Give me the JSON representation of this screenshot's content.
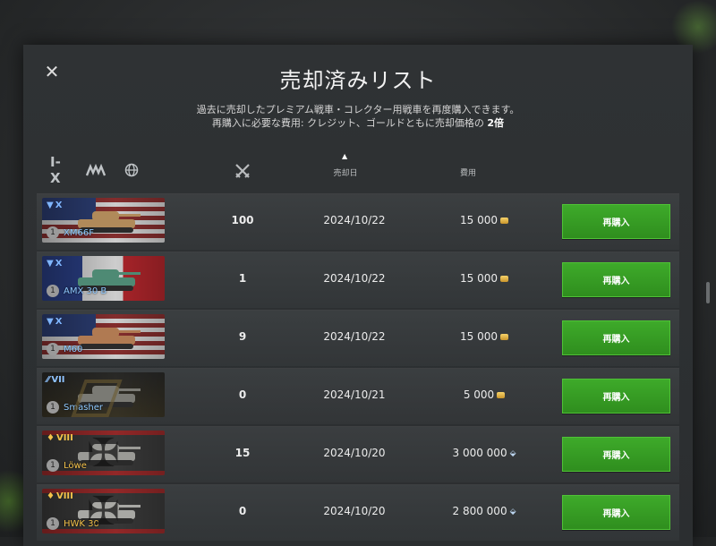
{
  "title": "売却済みリスト",
  "subtitle_line1": "過去に売却したプレミアム戦車・コレクター用戦車を再度購入できます。",
  "subtitle_line2_prefix": "再購入に必要な費用: クレジット、ゴールドともに売却価格の",
  "subtitle_line2_emphasis": "2倍",
  "filters": {
    "tier_label": "I-X",
    "class_icon": "vehicle-class-icon",
    "nation_icon": "globe-icon"
  },
  "columns": {
    "battles_icon": "crossed-swords-icon",
    "date": "売却日",
    "cost": "費用"
  },
  "sort_indicator": "▲",
  "rows": [
    {
      "tier": "X",
      "tier_style": "blue",
      "name": "XM66F",
      "name_style": "blue",
      "level": "1",
      "flag": "us",
      "tank_color": "#b08a5a",
      "battles": "100",
      "date": "2024/10/22",
      "cost": "15 000",
      "currency": "credits",
      "button": "再購入"
    },
    {
      "tier": "X",
      "tier_style": "blue",
      "name": "AMX 30 B",
      "name_style": "blue",
      "level": "1",
      "flag": "fr",
      "tank_color": "#4e8a74",
      "battles": "1",
      "date": "2024/10/22",
      "cost": "15 000",
      "currency": "credits",
      "button": "再購入"
    },
    {
      "tier": "X",
      "tier_style": "blue",
      "name": "M60",
      "name_style": "blue",
      "level": "1",
      "flag": "us",
      "tank_color": "#b07a52",
      "battles": "9",
      "date": "2024/10/22",
      "cost": "15 000",
      "currency": "credits",
      "button": "再購入"
    },
    {
      "tier": "VII",
      "tier_style": "blue2",
      "name": "Smasher",
      "name_style": "blue",
      "level": "1",
      "flag": "dark",
      "tank_color": "#7a7a74",
      "battles": "0",
      "date": "2024/10/21",
      "cost": "5 000",
      "currency": "credits",
      "button": "再購入"
    },
    {
      "tier": "VIII",
      "tier_style": "gold",
      "name": "Löwe",
      "name_style": "gold",
      "level": "1",
      "flag": "ger",
      "tank_color": "#9a9a96",
      "battles": "15",
      "date": "2024/10/20",
      "cost": "3 000 000",
      "currency": "crystals",
      "button": "再購入"
    },
    {
      "tier": "VIII",
      "tier_style": "gold",
      "name": "HWK 30",
      "name_style": "gold",
      "level": "1",
      "flag": "ger",
      "tank_color": "#a8a8a4",
      "battles": "0",
      "date": "2024/10/20",
      "cost": "2 800 000",
      "currency": "crystals",
      "button": "再購入"
    }
  ],
  "close_icon": "close-icon"
}
